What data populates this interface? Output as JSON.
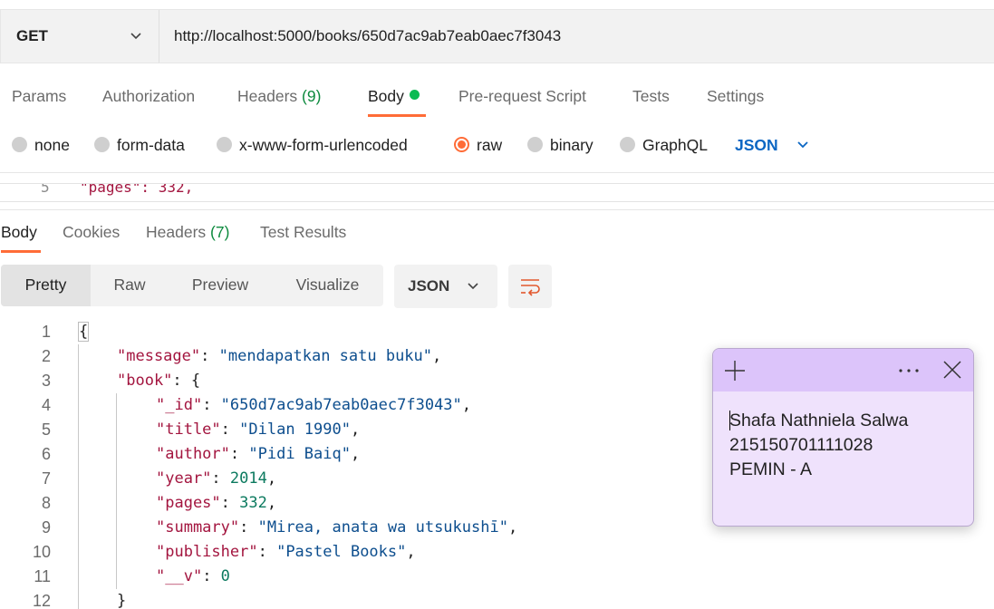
{
  "request": {
    "method": "GET",
    "url": "http://localhost:5000/books/650d7ac9ab7eab0aec7f3043",
    "tabs": [
      {
        "label": "Params",
        "count": ""
      },
      {
        "label": "Authorization",
        "count": ""
      },
      {
        "label": "Headers",
        "count": "(9)"
      },
      {
        "label": "Body",
        "count": ""
      },
      {
        "label": "Pre-request Script",
        "count": ""
      },
      {
        "label": "Tests",
        "count": ""
      },
      {
        "label": "Settings",
        "count": ""
      }
    ],
    "active_tab": "Body",
    "body_types": [
      "none",
      "form-data",
      "x-www-form-urlencoded",
      "raw",
      "binary",
      "GraphQL"
    ],
    "selected_body_type": "raw",
    "raw_format": "JSON",
    "editor_peek": {
      "line": "5",
      "code": "\"pages\": 332,"
    }
  },
  "response": {
    "tabs": [
      {
        "label": "Body",
        "count": ""
      },
      {
        "label": "Cookies",
        "count": ""
      },
      {
        "label": "Headers",
        "count": "(7)"
      },
      {
        "label": "Test Results",
        "count": ""
      }
    ],
    "active_tab": "Body",
    "views": [
      "Pretty",
      "Raw",
      "Preview",
      "Visualize"
    ],
    "active_view": "Pretty",
    "format": "JSON",
    "line_numbers": [
      "1",
      "2",
      "3",
      "4",
      "5",
      "6",
      "7",
      "8",
      "9",
      "10",
      "11",
      "12"
    ],
    "json": {
      "message_key": "\"message\"",
      "message_val": "\"mendapatkan satu buku\"",
      "book_key": "\"book\"",
      "fields": [
        {
          "key": "\"_id\"",
          "val": "\"650d7ac9ab7eab0aec7f3043\"",
          "kind": "s"
        },
        {
          "key": "\"title\"",
          "val": "\"Dilan 1990\"",
          "kind": "s"
        },
        {
          "key": "\"author\"",
          "val": "\"Pidi Baiq\"",
          "kind": "s"
        },
        {
          "key": "\"year\"",
          "val": "2014",
          "kind": "n"
        },
        {
          "key": "\"pages\"",
          "val": "332",
          "kind": "n"
        },
        {
          "key": "\"summary\"",
          "val": "\"Mirea, anata wa utsukushī\"",
          "kind": "s"
        },
        {
          "key": "\"publisher\"",
          "val": "\"Pastel Books\"",
          "kind": "s"
        },
        {
          "key": "\"__v\"",
          "val": "0",
          "kind": "n"
        }
      ]
    }
  },
  "sticky_note": {
    "lines": [
      "Shafa Nathniela Salwa",
      "215150701111028",
      "PEMIN - A"
    ],
    "color": "#efe2fc",
    "header_color": "#dcc4fa"
  },
  "colors": {
    "accent": "#ff6c37",
    "active_dot": "#0cbb52",
    "count_green": "#0d8a3e",
    "json_blue": "#0b66c3"
  }
}
